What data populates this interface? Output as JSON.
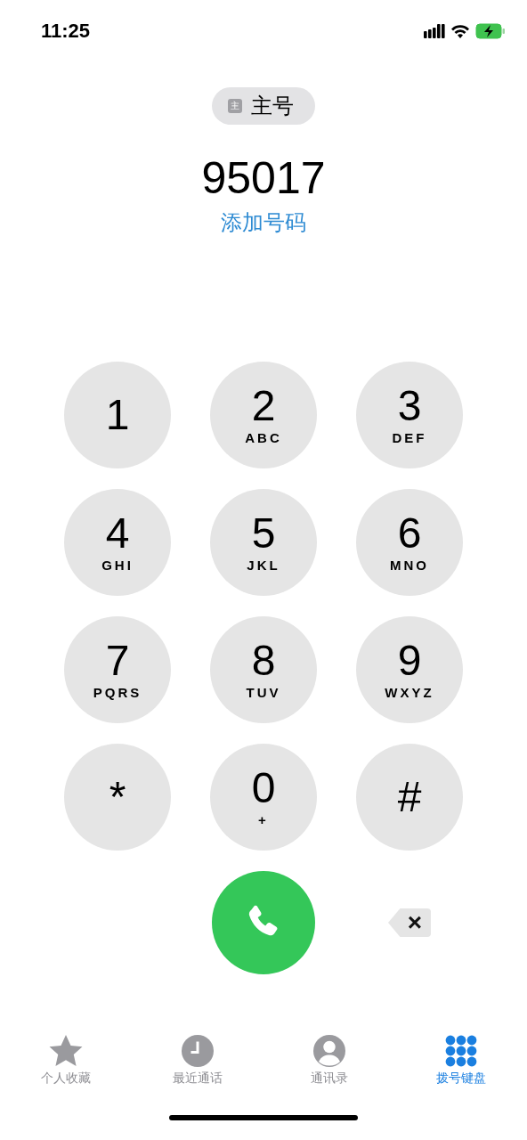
{
  "status_bar": {
    "time": "11:25"
  },
  "line_selector": {
    "badge": "主",
    "label": "主号"
  },
  "number": "95017",
  "add_number": "添加号码",
  "keys": [
    {
      "digit": "1"
    },
    {
      "digit": "2",
      "letters": "ABC"
    },
    {
      "digit": "3",
      "letters": "DEF"
    },
    {
      "digit": "4",
      "letters": "GHI"
    },
    {
      "digit": "5",
      "letters": "JKL"
    },
    {
      "digit": "6",
      "letters": "MNO"
    },
    {
      "digit": "7",
      "letters": "PQRS"
    },
    {
      "digit": "8",
      "letters": "TUV"
    },
    {
      "digit": "9",
      "letters": "WXYZ"
    },
    {
      "digit": "*"
    },
    {
      "digit": "0",
      "letters": "+"
    },
    {
      "digit": "#"
    }
  ],
  "delete_key": "×",
  "tabs": [
    {
      "kind": "star",
      "label": "个人收藏",
      "selected": false
    },
    {
      "kind": "clock",
      "label": "最近通话",
      "selected": false
    },
    {
      "kind": "person",
      "label": "通讯录",
      "selected": false
    },
    {
      "kind": "keypad",
      "label": "拨号键盘",
      "selected": true
    }
  ]
}
